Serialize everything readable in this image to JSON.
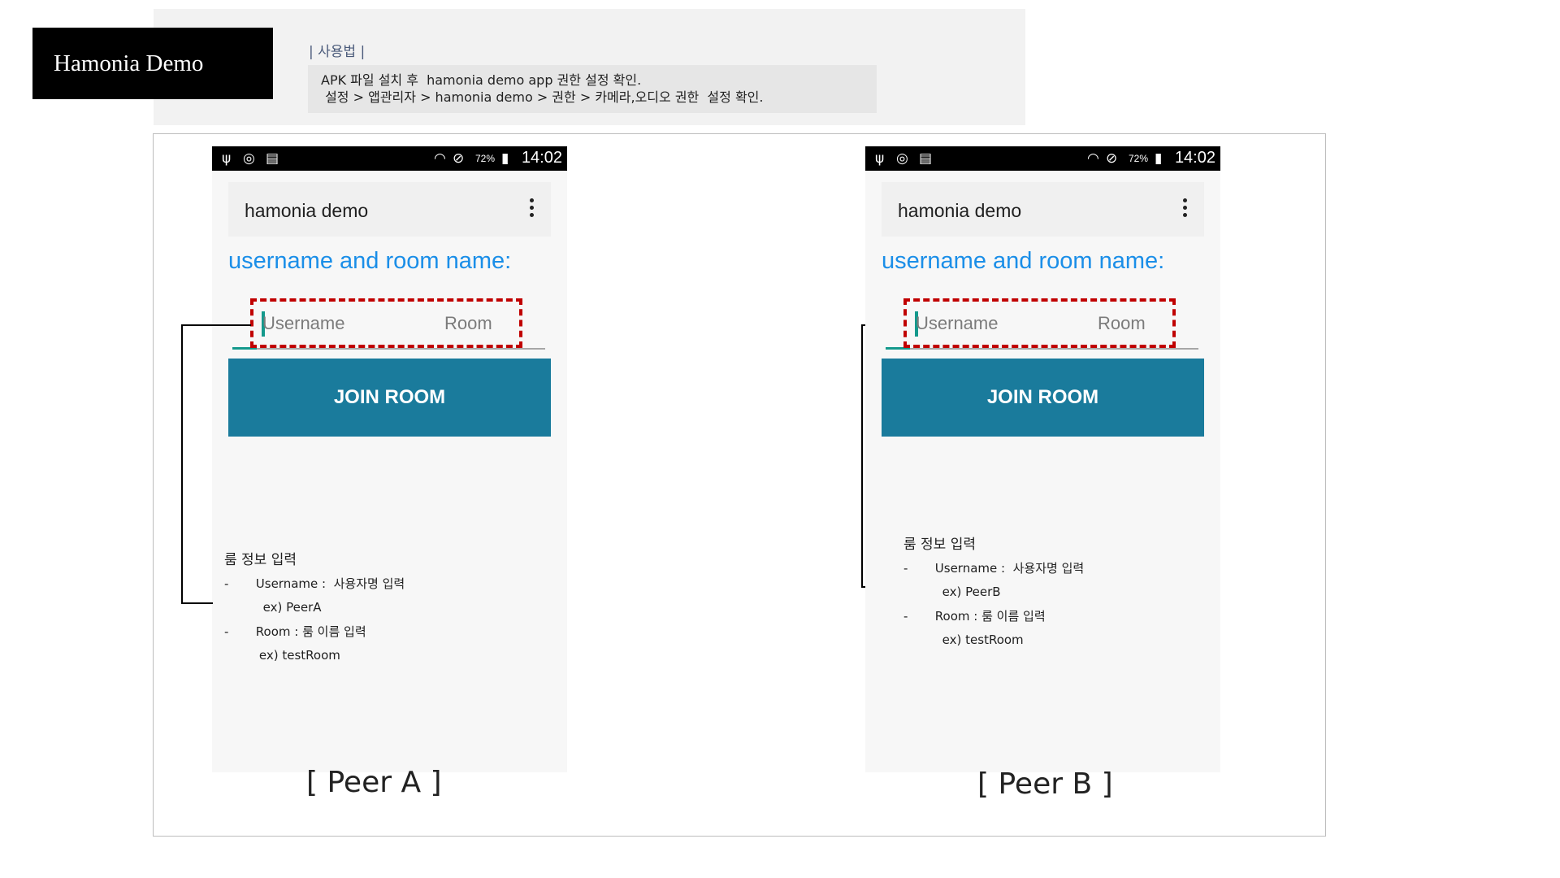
{
  "title": "Hamonia Demo",
  "usage": {
    "heading": "|  사용법  |",
    "lines": [
      "APK 파일 설치 후  hamonia demo app 권한 설정 확인.",
      " 설정 > 앱관리자 > hamonia demo > 권한 > 카메라,오디오 권한  설정 확인."
    ]
  },
  "phones": [
    {
      "status": {
        "battery": "72%",
        "time": "14:02"
      },
      "app_title": "hamonia demo",
      "prompt": "username and room name:",
      "username_placeholder": "Username",
      "room_placeholder": "Room",
      "join_label": "JOIN ROOM",
      "caption": "[ Peer A ]",
      "note": {
        "title": "룸 정보 입력",
        "lines": [
          "-       Username :  사용자명 입력",
          "          ex) PeerA",
          "-       Room : 룸 이름 입력",
          "         ex) testRoom"
        ]
      }
    },
    {
      "status": {
        "battery": "72%",
        "time": "14:02"
      },
      "app_title": "hamonia demo",
      "prompt": "username and room name:",
      "username_placeholder": "Username",
      "room_placeholder": "Room",
      "join_label": "JOIN ROOM",
      "caption": "[ Peer B ]",
      "note": {
        "title": "룸 정보 입력",
        "lines": [
          "-       Username :  사용자명 입력",
          "          ex) PeerB",
          "-       Room : 룸 이름 입력",
          "          ex) testRoom"
        ]
      }
    }
  ],
  "colors": {
    "accent_blue": "#1a8ee8",
    "button": "#1a7b9c",
    "highlight": "#c00000",
    "cursor": "#14998c"
  },
  "icons": [
    "usb-icon",
    "sync-icon",
    "sim-icon",
    "wifi-icon",
    "no-sign-icon",
    "battery-icon",
    "overflow-menu-icon"
  ]
}
